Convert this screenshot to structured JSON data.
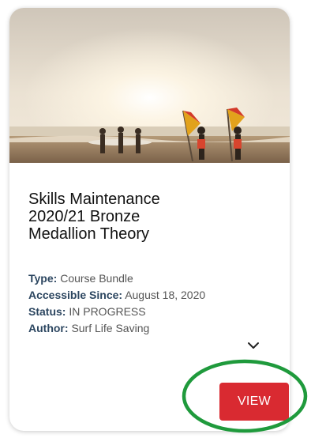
{
  "card": {
    "title_lines": [
      "Skills Maintenance",
      "2020/21 Bronze",
      "Medallion Theory"
    ],
    "details": [
      {
        "key": "Type:",
        "value": "Course Bundle"
      },
      {
        "key": "Accessible Since:",
        "value": "August 18, 2020"
      },
      {
        "key": "Status:",
        "value": "IN PROGRESS"
      },
      {
        "key": "Author:",
        "value": "Surf Life Saving"
      }
    ],
    "view_label": "VIEW",
    "expand_icon": "chevron-down-icon",
    "hero_image": "beach-surfers-flags-image"
  },
  "colors": {
    "view_button": "#d92a31",
    "highlight_ring": "#1f9a3c",
    "detail_key": "#2c4660"
  }
}
